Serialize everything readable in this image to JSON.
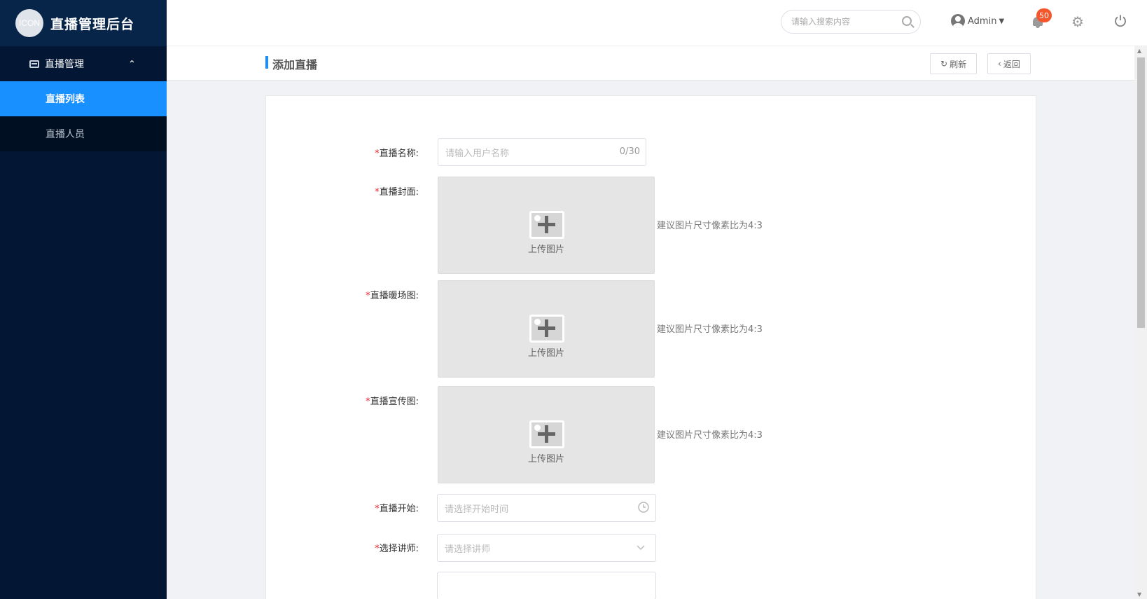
{
  "app": {
    "title": "直播管理后台",
    "logo_text": "ICON"
  },
  "sidebar": {
    "group_label": "直播管理",
    "items": [
      {
        "label": "直播列表",
        "active": true
      },
      {
        "label": "直播人员",
        "active": false
      }
    ]
  },
  "header": {
    "search_placeholder": "请输入搜索内容",
    "user_name": "Admin",
    "notification_count": "50"
  },
  "page": {
    "title": "添加直播",
    "refresh_label": "刷新",
    "back_label": "返回"
  },
  "form": {
    "name_label": "直播名称:",
    "name_placeholder": "请输入用户名称",
    "name_counter": "0/30",
    "cover_label": "直播封面:",
    "warmup_label": "直播暖场图:",
    "promo_label": "直播宣传图:",
    "upload_text": "上传图片",
    "image_hint": "建议图片尺寸像素比为4:3",
    "start_label": "直播开始:",
    "start_placeholder": "请选择开始时间",
    "lecturer_label": "选择讲师:",
    "lecturer_placeholder": "请选择讲师",
    "required_mark": "*"
  },
  "colors": {
    "sidebar_bg": "#031734",
    "brand_bg": "#062548",
    "accent": "#1890ff",
    "badge": "#f5562b"
  }
}
